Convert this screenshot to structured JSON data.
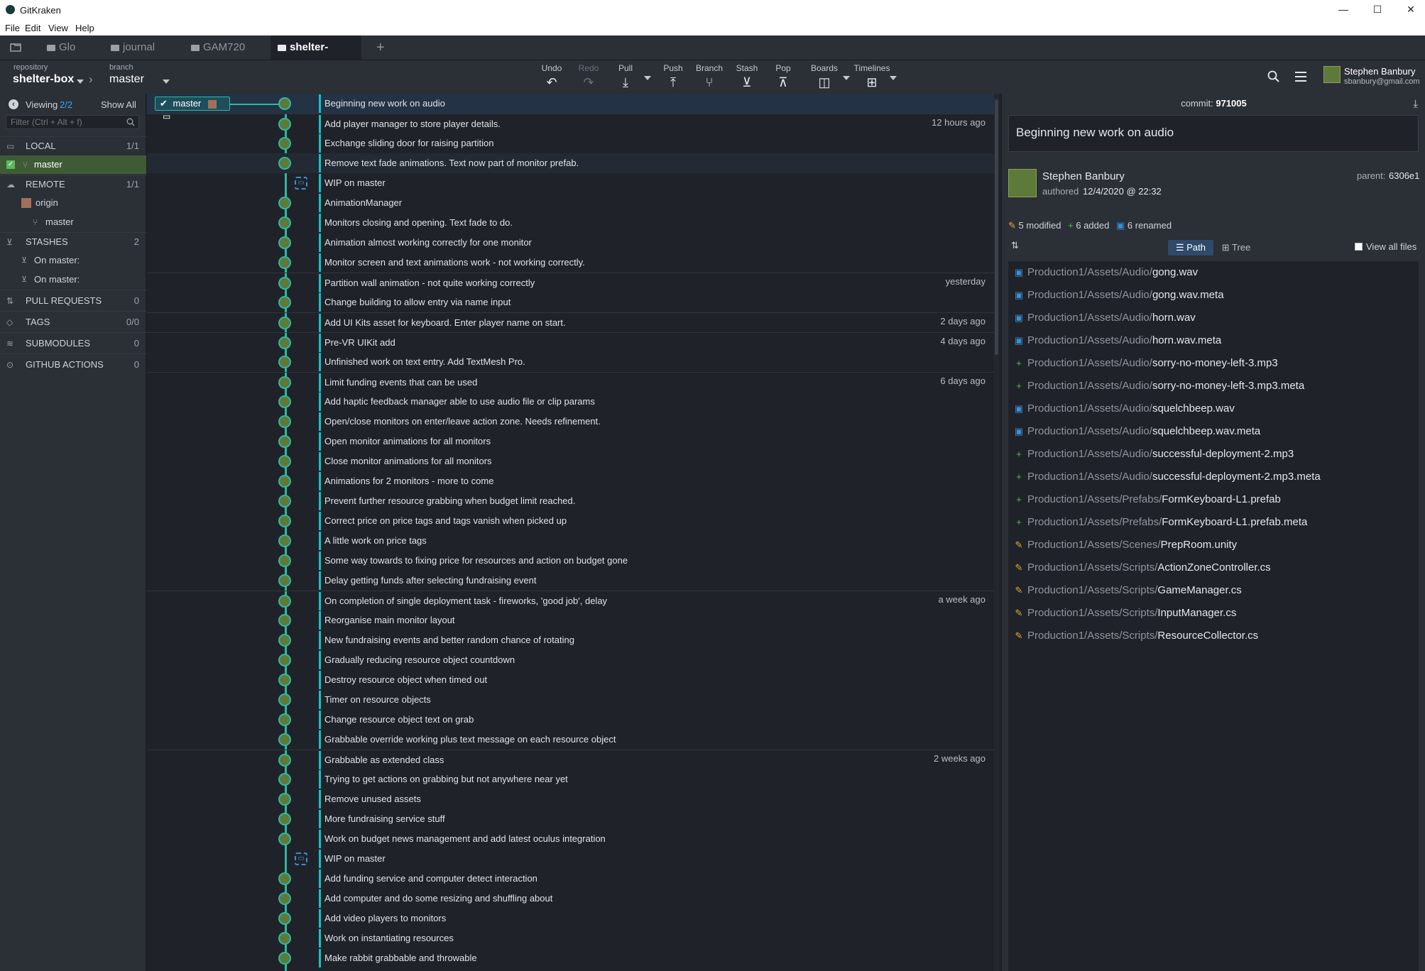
{
  "window": {
    "title": "GitKraken",
    "menu": [
      "File",
      "Edit",
      "View",
      "Help"
    ],
    "controls": {
      "minimize": "—",
      "maximize": "☐",
      "close": "✕"
    }
  },
  "tabs": [
    {
      "label": "Glo"
    },
    {
      "label": "journal"
    },
    {
      "label": "GAM720"
    },
    {
      "label": "shelter-box"
    }
  ],
  "toolbar": {
    "repo_caption": "repository",
    "repo_name": "shelter-box",
    "branch_caption": "branch",
    "branch_name": "master",
    "actions": [
      "Undo",
      "Redo",
      "Pull",
      "Push",
      "Branch",
      "Stash",
      "Pop",
      "Boards",
      "Timelines"
    ],
    "user_name": "Stephen Banbury",
    "user_email": "sbanbury@gmail.com"
  },
  "left": {
    "viewing_label": "Viewing",
    "viewing_count": "2/2",
    "show_all": "Show All",
    "filter_placeholder": "Filter (Ctrl + Alt + f)",
    "local_label": "LOCAL",
    "local_count": "1/1",
    "local_branch": "master",
    "remote_label": "REMOTE",
    "remote_count": "1/1",
    "remote_origin": "origin",
    "remote_branch": "master",
    "stashes_label": "STASHES",
    "stashes_count": "2",
    "stash_items": [
      "On master:",
      "On master:"
    ],
    "pull_requests_label": "PULL REQUESTS",
    "pull_requests_count": "0",
    "tags_label": "TAGS",
    "tags_count": "0/0",
    "submodules_label": "SUBMODULES",
    "submodules_count": "0",
    "github_actions_label": "GITHUB ACTIONS",
    "github_actions_count": "0"
  },
  "graph": {
    "branch_tag": "master",
    "commits": [
      {
        "msg": "Beginning new work on audio",
        "time": ""
      },
      {
        "msg": "Add player manager to store player details.",
        "time": "12 hours ago"
      },
      {
        "msg": "Exchange sliding door for raising partition",
        "time": ""
      },
      {
        "msg": "Remove text fade animations. Text now part of monitor prefab.",
        "time": ""
      },
      {
        "msg": "WIP on master",
        "time": ""
      },
      {
        "msg": "AnimationManager",
        "time": ""
      },
      {
        "msg": "Monitors closing and opening. Text fade to do.",
        "time": ""
      },
      {
        "msg": "Animation almost working correctly for one monitor",
        "time": ""
      },
      {
        "msg": "Monitor screen and text animations work - not working correctly.",
        "time": ""
      },
      {
        "msg": "Partition wall animation - not quite working correctly",
        "time": "yesterday"
      },
      {
        "msg": "Change building to allow entry via name input",
        "time": ""
      },
      {
        "msg": "Add UI Kits asset for keyboard. Enter player name on start.",
        "time": "2 days ago"
      },
      {
        "msg": "Pre-VR UIKit add",
        "time": "4 days ago"
      },
      {
        "msg": "Unfinished work on text entry. Add TextMesh Pro.",
        "time": ""
      },
      {
        "msg": "Limit funding events that can be used",
        "time": "6 days ago"
      },
      {
        "msg": "Add haptic feedback manager able to use audio file or clip params",
        "time": ""
      },
      {
        "msg": "Open/close monitors on enter/leave action zone. Needs refinement.",
        "time": ""
      },
      {
        "msg": "Open monitor animations for all monitors",
        "time": ""
      },
      {
        "msg": "Close monitor animations for all monitors",
        "time": ""
      },
      {
        "msg": "Animations for 2 monitors - more to come",
        "time": ""
      },
      {
        "msg": "Prevent further resource grabbing when budget limit reached.",
        "time": ""
      },
      {
        "msg": "Correct price on price tags and tags vanish when picked up",
        "time": ""
      },
      {
        "msg": "A little work on price tags",
        "time": ""
      },
      {
        "msg": "Some way towards to fixing price for resources and action on budget gone",
        "time": ""
      },
      {
        "msg": "Delay getting funds after selecting fundraising event",
        "time": ""
      },
      {
        "msg": "On completion of single deployment task - fireworks, 'good job', delay",
        "time": "a week ago"
      },
      {
        "msg": "Reorganise main monitor layout",
        "time": ""
      },
      {
        "msg": "New fundraising events and better random chance of rotating",
        "time": ""
      },
      {
        "msg": "Gradually reducing resource object countdown",
        "time": ""
      },
      {
        "msg": "Destroy resource object when timed out",
        "time": ""
      },
      {
        "msg": "Timer on resource objects",
        "time": ""
      },
      {
        "msg": "Change resource object text on grab",
        "time": ""
      },
      {
        "msg": "Grabbable override working plus text message on each resource object",
        "time": ""
      },
      {
        "msg": "Grabbable as extended class",
        "time": "2 weeks ago"
      },
      {
        "msg": "Trying to get actions on grabbing but not anywhere near yet",
        "time": ""
      },
      {
        "msg": "Remove unused assets",
        "time": ""
      },
      {
        "msg": "More fundraising service stuff",
        "time": ""
      },
      {
        "msg": "Work on budget news management and add latest oculus integration",
        "time": ""
      },
      {
        "msg": "WIP on master",
        "time": ""
      },
      {
        "msg": "Add funding service and computer detect interaction",
        "time": ""
      },
      {
        "msg": "Add computer and do some resizing and shuffling about",
        "time": ""
      },
      {
        "msg": "Add video players to monitors",
        "time": ""
      },
      {
        "msg": "Work on instantiating resources",
        "time": ""
      },
      {
        "msg": "Make rabbit grabbable and throwable",
        "time": ""
      }
    ]
  },
  "detail": {
    "commit_label": "commit:",
    "commit_sha": "971005",
    "summary": "Beginning new work on audio",
    "author": "Stephen Banbury",
    "authored_label": "authored",
    "authored_date": "12/4/2020 @ 22:32",
    "parent_label": "parent:",
    "parent_sha": "6306e1",
    "modified": "5 modified",
    "added": "6 added",
    "renamed": "6 renamed",
    "view_path": "Path",
    "view_tree": "Tree",
    "view_all_files": "View all files",
    "files": [
      {
        "dir": "Production1/Assets/Audio/",
        "name": "gong.wav",
        "status": "renamed"
      },
      {
        "dir": "Production1/Assets/Audio/",
        "name": "gong.wav.meta",
        "status": "renamed"
      },
      {
        "dir": "Production1/Assets/Audio/",
        "name": "horn.wav",
        "status": "renamed"
      },
      {
        "dir": "Production1/Assets/Audio/",
        "name": "horn.wav.meta",
        "status": "renamed"
      },
      {
        "dir": "Production1/Assets/Audio/",
        "name": "sorry-no-money-left-3.mp3",
        "status": "added"
      },
      {
        "dir": "Production1/Assets/Audio/",
        "name": "sorry-no-money-left-3.mp3.meta",
        "status": "added"
      },
      {
        "dir": "Production1/Assets/Audio/",
        "name": "squelchbeep.wav",
        "status": "renamed"
      },
      {
        "dir": "Production1/Assets/Audio/",
        "name": "squelchbeep.wav.meta",
        "status": "renamed"
      },
      {
        "dir": "Production1/Assets/Audio/",
        "name": "successful-deployment-2.mp3",
        "status": "added"
      },
      {
        "dir": "Production1/Assets/Audio/",
        "name": "successful-deployment-2.mp3.meta",
        "status": "added"
      },
      {
        "dir": "Production1/Assets/Prefabs/",
        "name": "FormKeyboard-L1.prefab",
        "status": "added"
      },
      {
        "dir": "Production1/Assets/Prefabs/",
        "name": "FormKeyboard-L1.prefab.meta",
        "status": "added"
      },
      {
        "dir": "Production1/Assets/Scenes/",
        "name": "PrepRoom.unity",
        "status": "modified"
      },
      {
        "dir": "Production1/Assets/Scripts/",
        "name": "ActionZoneController.cs",
        "status": "modified"
      },
      {
        "dir": "Production1/Assets/Scripts/",
        "name": "GameManager.cs",
        "status": "modified"
      },
      {
        "dir": "Production1/Assets/Scripts/",
        "name": "InputManager.cs",
        "status": "modified"
      },
      {
        "dir": "Production1/Assets/Scripts/",
        "name": "ResourceCollector.cs",
        "status": "modified"
      }
    ]
  },
  "colors": {
    "accent": "#14c1c9",
    "graph_line": "#2fb8a0",
    "modified": "#e8a33d",
    "added": "#5cb85c",
    "renamed": "#3a8fd8",
    "selected_row": "#243246"
  }
}
